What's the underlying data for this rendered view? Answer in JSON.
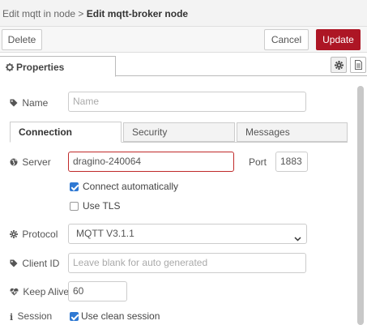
{
  "breadcrumb": {
    "parent": "Edit mqtt in node",
    "separator": ">",
    "current": "Edit mqtt-broker node"
  },
  "actions": {
    "delete_label": "Delete",
    "cancel_label": "Cancel",
    "update_label": "Update"
  },
  "colors": {
    "accent": "#ad1625",
    "checkbox": "#2f79d3",
    "server_border": "#c02a2a"
  },
  "tabs": {
    "properties_label": "Properties"
  },
  "form": {
    "name": {
      "label": "Name",
      "placeholder": "Name",
      "value": ""
    },
    "subtabs": [
      "Connection",
      "Security",
      "Messages"
    ],
    "server": {
      "label": "Server",
      "value": "dragino-240064"
    },
    "port": {
      "label": "Port",
      "value": "1883"
    },
    "connect_auto": {
      "label": "Connect automatically",
      "checked": true
    },
    "use_tls": {
      "label": "Use TLS",
      "checked": false
    },
    "protocol": {
      "label": "Protocol",
      "selected": "MQTT V3.1.1"
    },
    "client_id": {
      "label": "Client ID",
      "placeholder": "Leave blank for auto generated",
      "value": ""
    },
    "keep_alive": {
      "label": "Keep Alive",
      "value": "60"
    },
    "session": {
      "label": "Session",
      "checkbox_label": "Use clean session",
      "checked": true
    }
  },
  "icons": [
    "gear-icon",
    "tag-icon",
    "globe-icon",
    "id-card-icon",
    "heartbeat-icon",
    "info-icon",
    "document-icon",
    "chevron-down-icon"
  ]
}
